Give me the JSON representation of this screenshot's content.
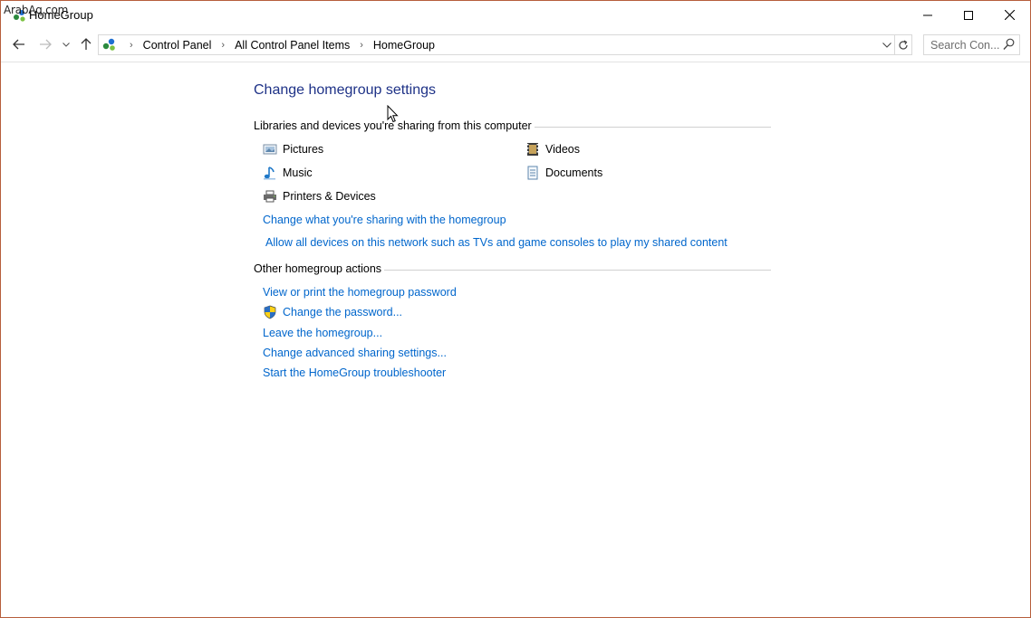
{
  "window": {
    "title": "HomeGroup",
    "watermark": "ArabAq.com"
  },
  "nav": {
    "breadcrumbs": [
      "Control Panel",
      "All Control Panel Items",
      "HomeGroup"
    ],
    "search_placeholder": "Search Con..."
  },
  "main": {
    "title": "Change homegroup settings",
    "sharing_section": {
      "heading": "Libraries and devices you're sharing from this computer",
      "items": [
        {
          "label": "Pictures",
          "icon": "pictures-icon"
        },
        {
          "label": "Videos",
          "icon": "videos-icon"
        },
        {
          "label": "Music",
          "icon": "music-icon"
        },
        {
          "label": "Documents",
          "icon": "documents-icon"
        },
        {
          "label": "Printers & Devices",
          "icon": "printer-icon"
        }
      ],
      "links": [
        "Change what you're sharing with the homegroup",
        "Allow all devices on this network such as TVs and game consoles to play my shared content"
      ]
    },
    "actions_section": {
      "heading": "Other homegroup actions",
      "links": [
        "View or print the homegroup password",
        "Change the password...",
        "Leave the homegroup...",
        "Change advanced sharing settings...",
        "Start the HomeGroup troubleshooter"
      ]
    }
  },
  "colors": {
    "title_blue": "#1e3287",
    "link_blue": "#0066cc",
    "window_border": "#b65e3c"
  }
}
